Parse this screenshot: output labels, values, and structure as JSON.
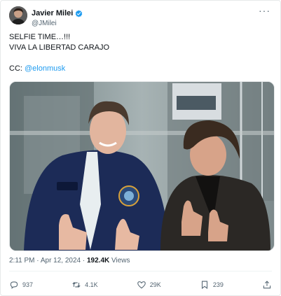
{
  "author": {
    "display_name": "Javier Milei",
    "handle": "@JMilei",
    "verified": true,
    "verified_color": "#1d9bf0"
  },
  "more_icon": "more-horizontal-icon",
  "tweet": {
    "line1": "SELFIE TIME…!!!",
    "line2": "VIVA LA LIBERTAD CARAJO",
    "cc_prefix": "CC: ",
    "mention": "@elonmusk",
    "mention_color": "#1d9bf0"
  },
  "meta": {
    "time": "2:11 PM",
    "separator": " · ",
    "date": "Apr 12, 2024",
    "views_count": "192.4K",
    "views_label": " Views"
  },
  "actions": {
    "reply": {
      "icon": "reply-icon",
      "count": "937"
    },
    "retweet": {
      "icon": "retweet-icon",
      "count": "4.1K"
    },
    "like": {
      "icon": "heart-icon",
      "count": "29K"
    },
    "bookmark": {
      "icon": "bookmark-icon",
      "count": "239"
    },
    "share": {
      "icon": "share-icon"
    }
  }
}
